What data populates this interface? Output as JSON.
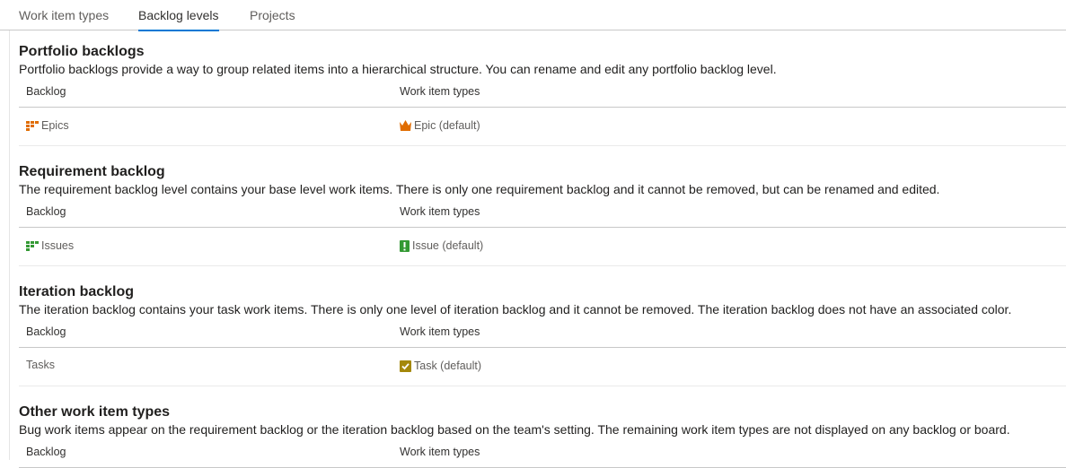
{
  "tabs": [
    {
      "label": "Work item types",
      "selected": false
    },
    {
      "label": "Backlog levels",
      "selected": true
    },
    {
      "label": "Projects",
      "selected": false
    }
  ],
  "colors": {
    "accent": "#0078d4",
    "epic": "#e06c00",
    "issue": "#339933",
    "task": "#a4880a",
    "requirement": "#339933"
  },
  "sections": [
    {
      "title": "Portfolio backlogs",
      "description": "Portfolio backlogs provide a way to group related items into a hierarchical structure. You can rename and edit any portfolio backlog level.",
      "col_backlog": "Backlog",
      "col_types": "Work item types",
      "row": {
        "backlog": "Epics",
        "backlog_icon": "backlog-level-icon",
        "type": "Epic (default)",
        "type_icon": "crown-icon"
      }
    },
    {
      "title": "Requirement backlog",
      "description": "The requirement backlog level contains your base level work items. There is only one requirement backlog and it cannot be removed, but can be renamed and edited.",
      "col_backlog": "Backlog",
      "col_types": "Work item types",
      "row": {
        "backlog": "Issues",
        "backlog_icon": "backlog-level-icon",
        "type": "Issue (default)",
        "type_icon": "issue-icon"
      }
    },
    {
      "title": "Iteration backlog",
      "description": "The iteration backlog contains your task work items. There is only one level of iteration backlog and it cannot be removed. The iteration backlog does not have an associated color.",
      "col_backlog": "Backlog",
      "col_types": "Work item types",
      "row": {
        "backlog": "Tasks",
        "type": "Task (default)",
        "type_icon": "task-check-icon"
      }
    },
    {
      "title": "Other work item types",
      "description": "Bug work items appear on the requirement backlog or the iteration backlog based on the team's setting. The remaining work item types are not displayed on any backlog or board.",
      "col_backlog": "Backlog",
      "col_types": "Work item types"
    }
  ]
}
